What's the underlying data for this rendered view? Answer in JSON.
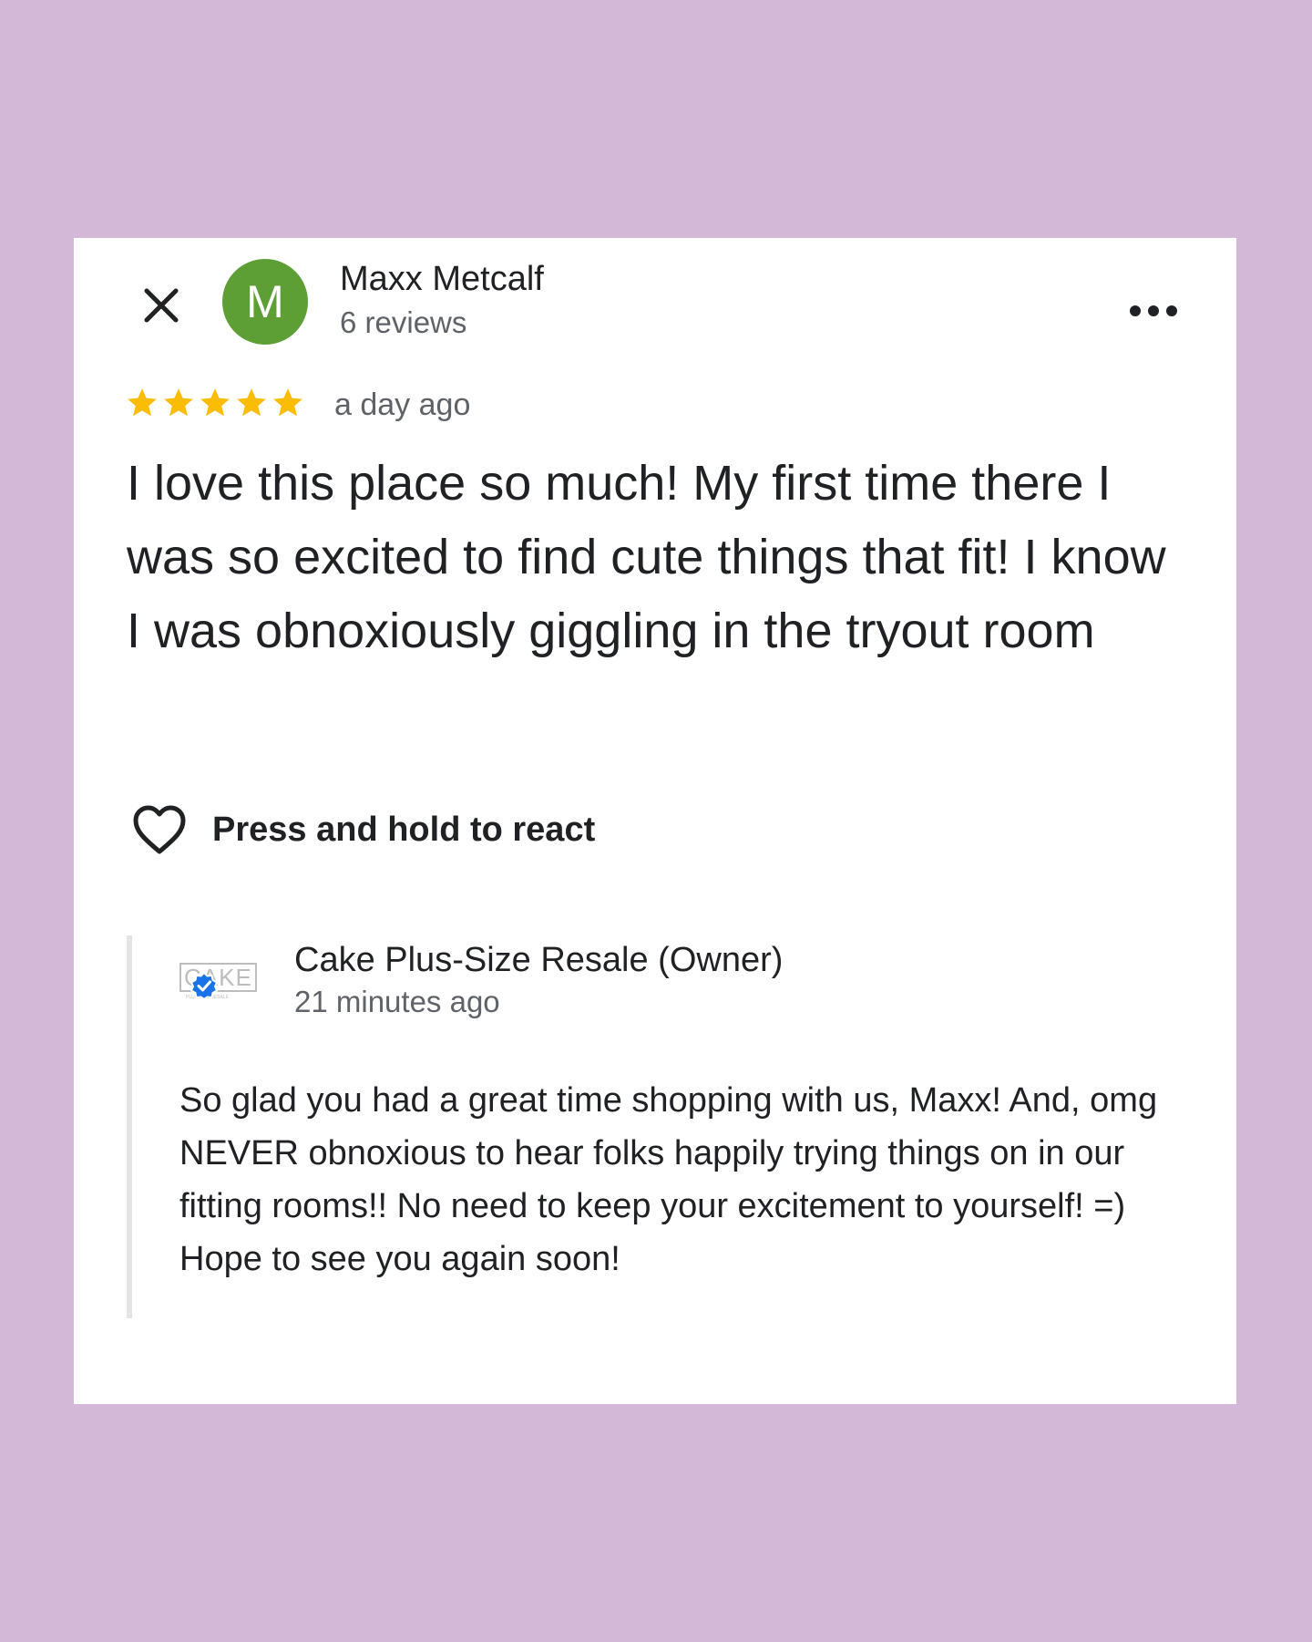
{
  "reviewer": {
    "avatar_initial": "M",
    "name": "Maxx Metcalf",
    "review_count": "6 reviews"
  },
  "review": {
    "rating": 5,
    "max_rating": 5,
    "time": "a day ago",
    "text": "I love this place so much! My first time there I was so excited to find cute things that fit! I know I was obnoxiously giggling in the tryout room"
  },
  "react": {
    "label": "Press and hold to react"
  },
  "owner_reply": {
    "logo_text": "CAKE",
    "logo_subtext": "PLUS-SIZE RESALE",
    "name": "Cake Plus-Size Resale (Owner)",
    "time": "21 minutes ago",
    "text": "So glad you had a great time shopping with us, Maxx! And, omg NEVER obnoxious to hear folks happily trying things on in our fitting rooms!! No need to keep your excitement to yourself! =) Hope to see you again soon!"
  },
  "colors": {
    "background": "#d3b8d8",
    "avatar": "#5d9f35",
    "star": "#fbbc04",
    "verified": "#1a73e8"
  },
  "icons": {
    "close": "close-icon",
    "more": "more-horizontal-icon",
    "star": "star-icon",
    "heart": "heart-outline-icon",
    "verified": "verified-badge-icon"
  }
}
